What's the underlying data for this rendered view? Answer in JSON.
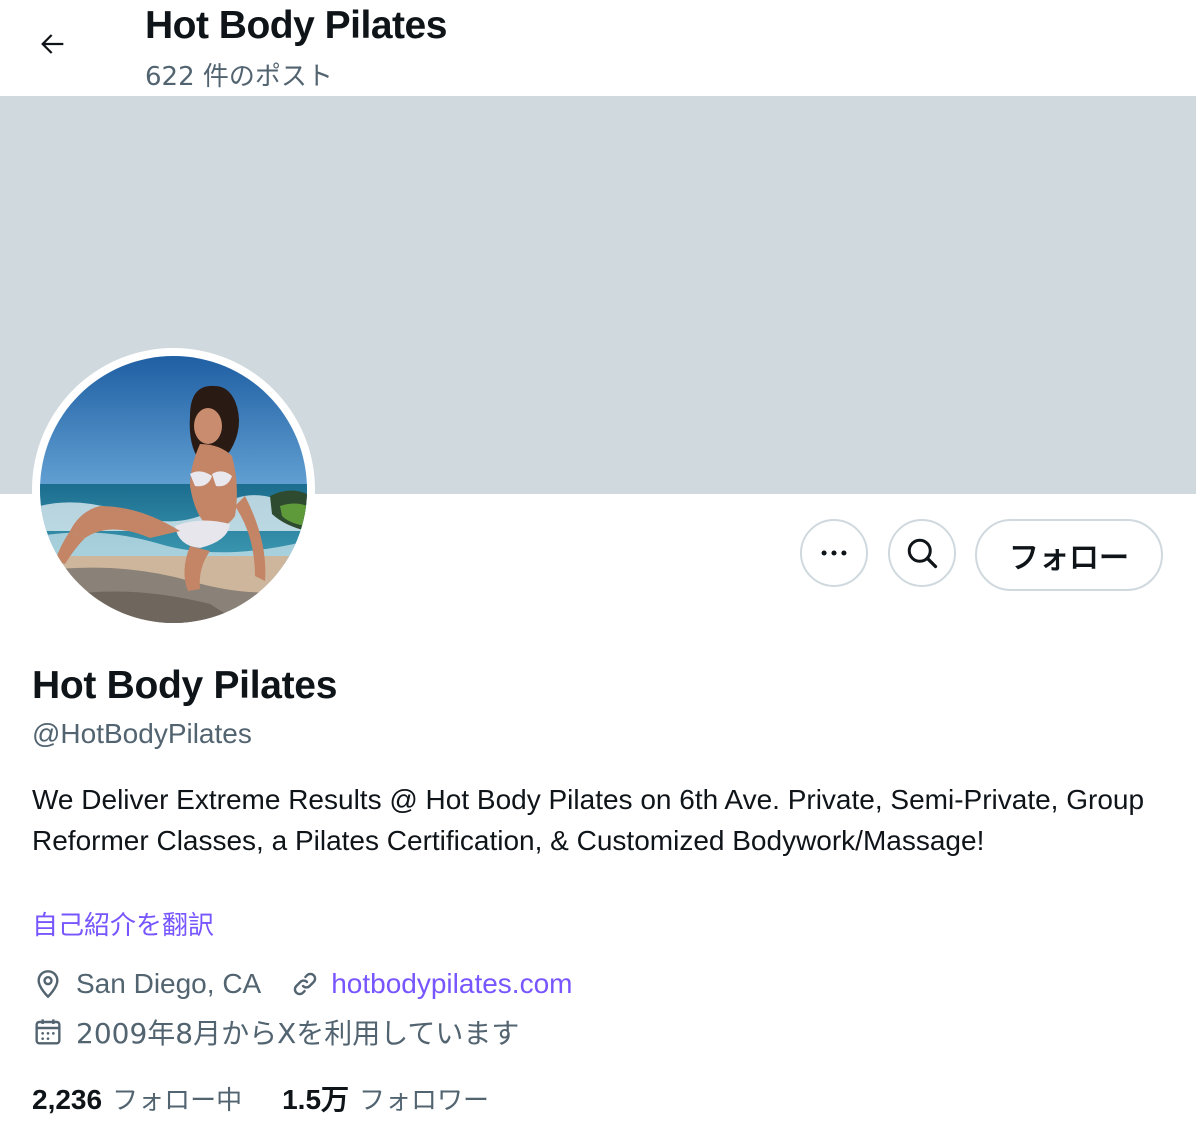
{
  "header": {
    "title": "Hot Body Pilates",
    "post_count": "622 件のポスト"
  },
  "profile": {
    "name": "Hot Body Pilates",
    "handle": "@HotBodyPilates",
    "bio": "We Deliver Extreme Results @ Hot Body Pilates on 6th Ave. Private, Semi-Private, Group Reformer Classes, a Pilates Certification, & Customized Bodywork/Massage!",
    "translate_label": "自己紹介を翻訳",
    "location": "San Diego, CA",
    "website": "hotbodypilates.com",
    "joined": "2009年8月からXを利用しています"
  },
  "actions": {
    "more_icon": "more-horizontal-icon",
    "search_icon": "search-icon",
    "follow_label": "フォロー"
  },
  "stats": {
    "following_count": "2,236",
    "following_label": "フォロー中",
    "followers_count": "1.5万",
    "followers_label": "フォロワー"
  },
  "colors": {
    "banner": "#cfd9de",
    "link": "#7856ff",
    "secondary_text": "#536471",
    "primary_text": "#0f1419"
  }
}
